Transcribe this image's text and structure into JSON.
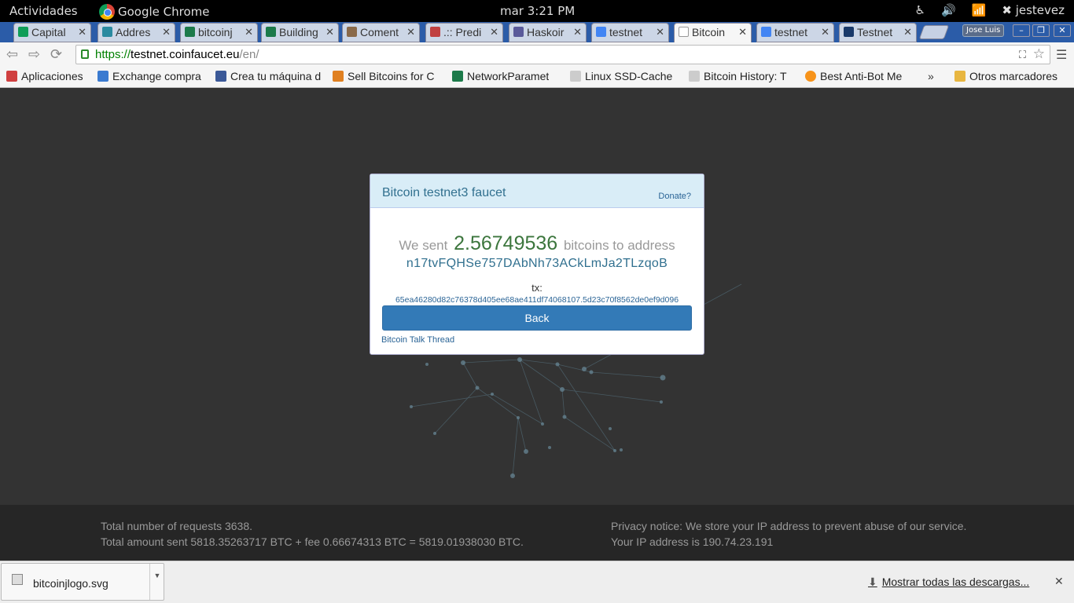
{
  "topbar": {
    "activities": "Actividades",
    "app_name": "Google Chrome",
    "clock": "mar  3:21 PM",
    "user": "jestevez"
  },
  "tabs": [
    {
      "label": "Capital",
      "icon_color": "#0f9d58"
    },
    {
      "label": "Addres",
      "icon_color": "#2a8aa0"
    },
    {
      "label": "bitcoinj",
      "icon_color": "#1c7a4a"
    },
    {
      "label": "Building",
      "icon_color": "#1c7a4a"
    },
    {
      "label": "Coment",
      "icon_color": "#8a6a4a"
    },
    {
      "label": ".:: Predi",
      "icon_color": "#c04040"
    },
    {
      "label": "Haskoir",
      "icon_color": "#5a5a9a"
    },
    {
      "label": "testnet",
      "icon_color": "#4285f4"
    },
    {
      "label": "Bitcoin",
      "icon_color": "#ffffff"
    },
    {
      "label": "testnet",
      "icon_color": "#4285f4"
    },
    {
      "label": "Testnet",
      "icon_color": "#1a3a6a"
    }
  ],
  "profile_name": "Jose Luis",
  "address_bar": {
    "scheme": "https://",
    "host": "testnet.coinfaucet.eu",
    "path": "/en/"
  },
  "bookmarks": [
    {
      "label": "Aplicaciones",
      "icon_color": "#d04040"
    },
    {
      "label": "Exchange compra",
      "icon_color": "#3a7ad0"
    },
    {
      "label": "Crea tu máquina d",
      "icon_color": "#3b5998"
    },
    {
      "label": "Sell Bitcoins for C",
      "icon_color": "#e08020"
    },
    {
      "label": "NetworkParamet",
      "icon_color": "#1c7a4a"
    },
    {
      "label": "Linux SSD-Cache",
      "icon_color": "#cccccc"
    },
    {
      "label": "Bitcoin History: T",
      "icon_color": "#cccccc"
    },
    {
      "label": "Best Anti-Bot Me",
      "icon_color": "#f7931a"
    }
  ],
  "bookmarks_overflow": "»",
  "other_bookmarks": "Otros marcadores",
  "modal": {
    "title": "Bitcoin testnet3 faucet",
    "donate": "Donate?",
    "sent_prefix": "We sent",
    "amount": "2.56749536",
    "sent_suffix": "bitcoins to address",
    "address": "n17tvFQHSe757DAbNh73ACkLmJa2TLzqoB",
    "tx_label": "tx:",
    "tx_hash": "65ea46280d82c76378d405ee68ae411df74068107.5d23c70f8562de0ef9d096",
    "back": "Back",
    "thread": "Bitcoin Talk Thread"
  },
  "footer": {
    "requests": "Total number of requests 3638.",
    "amount_sent": "Total amount sent 5818.35263717 BTC + fee 0.66674313 BTC = 5819.01938030 BTC.",
    "privacy": "Privacy notice: We store your IP address to prevent abuse of our service.",
    "ip": "Your IP address is 190.74.23.191"
  },
  "downloads": {
    "file": "bitcoinjlogo.svg",
    "show_all": "Mostrar todas las descargas..."
  },
  "colors": {
    "accent": "#337ab7",
    "panel_header": "#d9edf7",
    "amount": "#3c763d",
    "page_bg": "#333333"
  }
}
